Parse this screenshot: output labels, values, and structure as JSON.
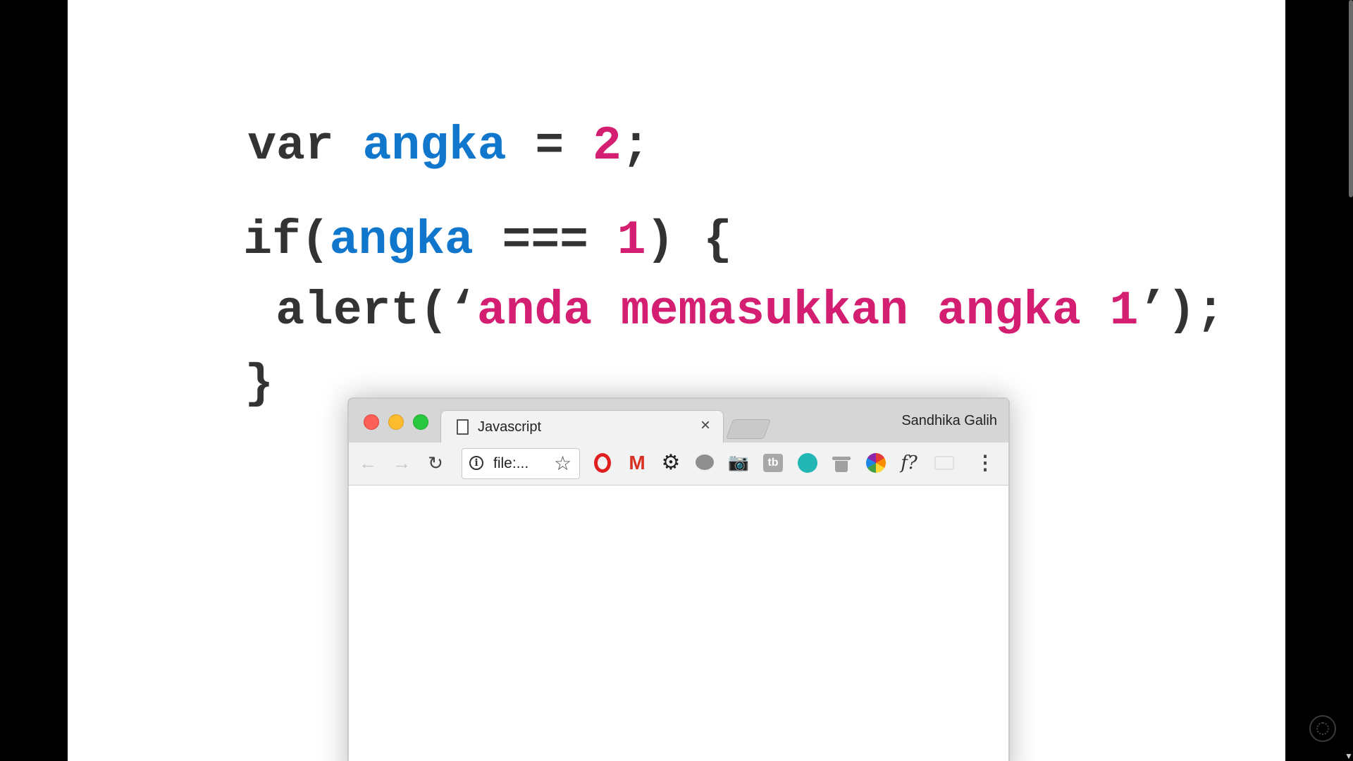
{
  "slide": {
    "code_lines": [
      [
        {
          "text": "var ",
          "color": "dark"
        },
        {
          "text": "angka",
          "color": "blue"
        },
        {
          "text": " = ",
          "color": "dark"
        },
        {
          "text": "2",
          "color": "pink"
        },
        {
          "text": ";",
          "color": "dark"
        }
      ],
      [
        {
          "text": "if(",
          "color": "dark"
        },
        {
          "text": "angka",
          "color": "blue"
        },
        {
          "text": " === ",
          "color": "dark"
        },
        {
          "text": "1",
          "color": "pink"
        },
        {
          "text": ") {",
          "color": "dark"
        }
      ],
      [
        {
          "text": "alert(‘",
          "color": "dark"
        },
        {
          "text": "anda memasukkan angka 1",
          "color": "pink"
        },
        {
          "text": "’);",
          "color": "dark"
        }
      ],
      [
        {
          "text": "}",
          "color": "dark"
        }
      ]
    ],
    "colors": {
      "dark": "#333333",
      "blue": "#1177cc",
      "pink": "#d31e72"
    }
  },
  "browser": {
    "tab_title": "Javascript",
    "tab_close": "×",
    "profile_name": "Sandhika Galih",
    "toolbar": {
      "back_icon": "←",
      "forward_icon": "→",
      "reload_icon": "↻",
      "info_icon": "i",
      "url": "file:...",
      "star_icon": "☆",
      "menu_icon": "⋮"
    },
    "extensions": {
      "gmail": "M",
      "gear": "⚙",
      "camera": "📷",
      "tb": "tb",
      "font": "f?"
    }
  }
}
